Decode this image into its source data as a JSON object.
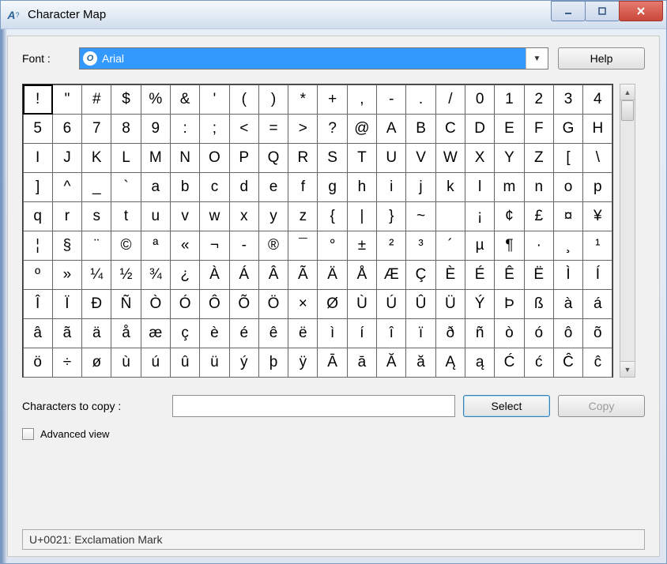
{
  "window": {
    "title": "Character Map"
  },
  "font_row": {
    "label": "Font :",
    "selected": "Arial"
  },
  "help_button": "Help",
  "grid": {
    "cols": 20,
    "selected_index": 0,
    "chars": [
      "!",
      "\"",
      "#",
      "$",
      "%",
      "&",
      "'",
      "(",
      ")",
      "*",
      "+",
      ",",
      "-",
      ".",
      "/",
      "0",
      "1",
      "2",
      "3",
      "4",
      "5",
      "6",
      "7",
      "8",
      "9",
      ":",
      ";",
      "<",
      "=",
      ">",
      "?",
      "@",
      "A",
      "B",
      "C",
      "D",
      "E",
      "F",
      "G",
      "H",
      "I",
      "J",
      "K",
      "L",
      "M",
      "N",
      "O",
      "P",
      "Q",
      "R",
      "S",
      "T",
      "U",
      "V",
      "W",
      "X",
      "Y",
      "Z",
      "[",
      "\\",
      "]",
      "^",
      "_",
      "`",
      "a",
      "b",
      "c",
      "d",
      "e",
      "f",
      "g",
      "h",
      "i",
      "j",
      "k",
      "l",
      "m",
      "n",
      "o",
      "p",
      "q",
      "r",
      "s",
      "t",
      "u",
      "v",
      "w",
      "x",
      "y",
      "z",
      "{",
      "|",
      "}",
      "~",
      " ",
      "¡",
      "¢",
      "£",
      "¤",
      "¥",
      "¦",
      "§",
      "¨",
      "©",
      "ª",
      "«",
      "¬",
      "-",
      "®",
      "¯",
      "°",
      "±",
      "²",
      "³",
      "´",
      "µ",
      "¶",
      "·",
      "¸",
      "¹",
      "º",
      "»",
      "¼",
      "½",
      "¾",
      "¿",
      "À",
      "Á",
      "Â",
      "Ã",
      "Ä",
      "Å",
      "Æ",
      "Ç",
      "È",
      "É",
      "Ê",
      "Ë",
      "Ì",
      "Í",
      "Î",
      "Ï",
      "Đ",
      "Ñ",
      "Ò",
      "Ó",
      "Ô",
      "Õ",
      "Ö",
      "×",
      "Ø",
      "Ù",
      "Ú",
      "Û",
      "Ü",
      "Ý",
      "Þ",
      "ß",
      "à",
      "á",
      "â",
      "ã",
      "ä",
      "å",
      "æ",
      "ç",
      "è",
      "é",
      "ê",
      "ë",
      "ì",
      "í",
      "î",
      "ï",
      "ð",
      "ñ",
      "ò",
      "ó",
      "ô",
      "õ",
      "ö",
      "÷",
      "ø",
      "ù",
      "ú",
      "û",
      "ü",
      "ý",
      "þ",
      "ÿ",
      "Ā",
      "ā",
      "Ă",
      "ă",
      "Ą",
      "ą",
      "Ć",
      "ć",
      "Ĉ",
      "ĉ"
    ]
  },
  "copy_row": {
    "label": "Characters to copy :",
    "value": "",
    "select_btn": "Select",
    "copy_btn": "Copy"
  },
  "advanced_view": {
    "label": "Advanced view",
    "checked": false
  },
  "status": "U+0021: Exclamation Mark"
}
